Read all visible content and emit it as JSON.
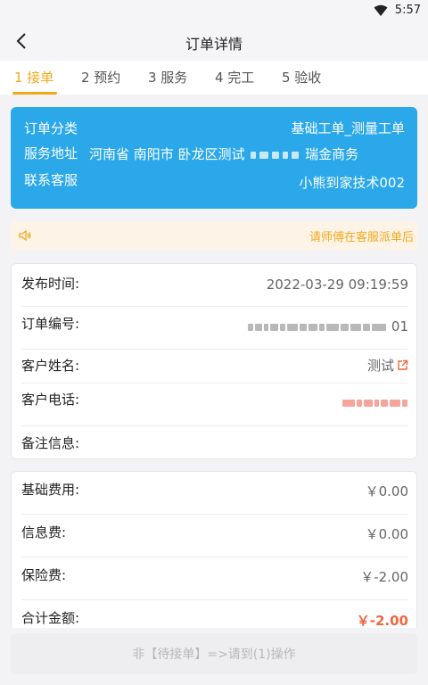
{
  "status_bar": {
    "time": "5:57"
  },
  "header": {
    "title": "订单详情"
  },
  "tabs": [
    {
      "label": "1 接单"
    },
    {
      "label": "2 预约"
    },
    {
      "label": "3 服务"
    },
    {
      "label": "4 完工"
    },
    {
      "label": "5 验收"
    }
  ],
  "info_card": {
    "category_label": "订单分类",
    "category_value": "基础工单_测量工单",
    "address_label": "服务地址",
    "address_prefix": "河南省 南阳市 卧龙区测试",
    "address_suffix": "瑞金商务",
    "contact_label": "联系客服",
    "contact_value": "小熊到家技术002",
    "card_color": "#2aa8ea"
  },
  "notice": {
    "text": "请师傅在客服派单后",
    "icon": "speaker-icon"
  },
  "details": {
    "publish_time_label": "发布时间:",
    "publish_time_value": "2022-03-29 09:19:59",
    "order_no_label": "订单编号:",
    "order_no_suffix": "01",
    "customer_name_label": "客户姓名:",
    "customer_name_value": "测试",
    "customer_phone_label": "客户电话:",
    "remark_label": "备注信息:"
  },
  "fees": {
    "base_label": "基础费用:",
    "base_value": "￥0.00",
    "info_label": "信息费:",
    "info_value": "￥0.00",
    "insurance_label": "保险费:",
    "insurance_value": "￥-2.00",
    "total_label": "合计金额:",
    "total_value": "￥-2.00"
  },
  "action": {
    "label": "非【待接单】=>请到(1)操作"
  },
  "colors": {
    "accent": "#f2a91e",
    "total": "#f0663e"
  }
}
